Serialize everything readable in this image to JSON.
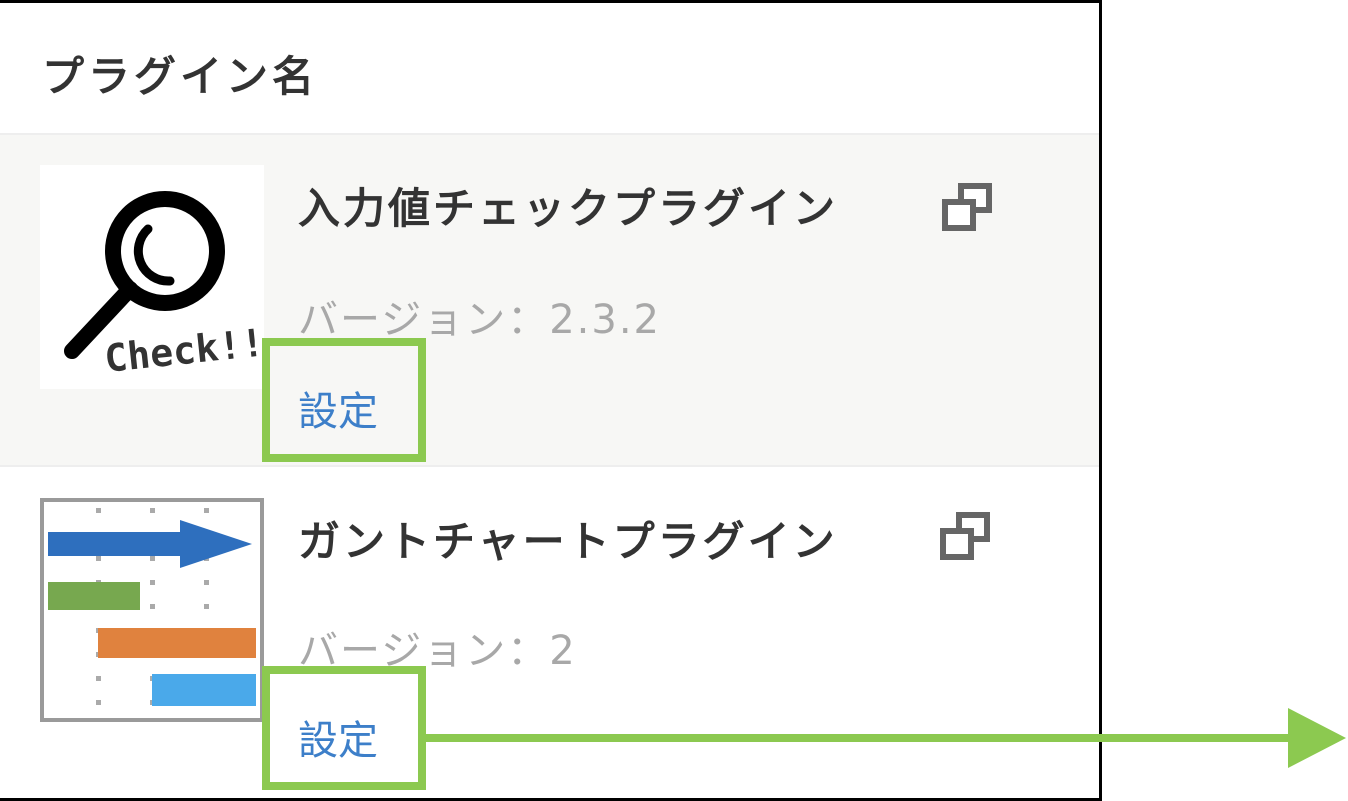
{
  "header": {
    "title": "プラグイン名"
  },
  "plugins": [
    {
      "name": "入力値チェックプラグイン",
      "version_label": "バージョン：2.3.2",
      "settings_label": "設定",
      "thumbnail_text": "Check!!",
      "thumbnail_icon": "magnifier-icon"
    },
    {
      "name": "ガントチャートプラグイン",
      "version_label": "バージョン：2",
      "settings_label": "設定",
      "thumbnail_icon": "gantt-chart-icon"
    }
  ],
  "colors": {
    "highlight": "#8cc950",
    "link": "#3d7fc9",
    "gantt_blue": "#2e6fbe",
    "gantt_green": "#77a84f",
    "gantt_orange": "#e0823e",
    "gantt_cyan": "#4aa9ea"
  }
}
